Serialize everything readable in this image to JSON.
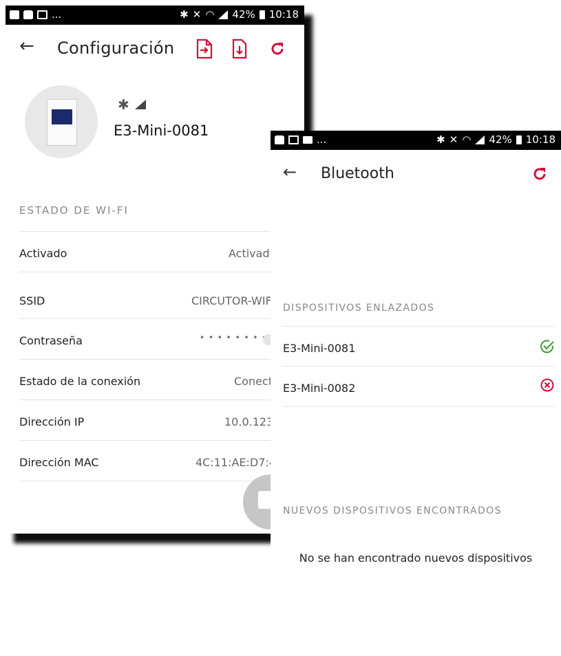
{
  "colors": {
    "accent": "#d0103a",
    "ok": "#3a9d2a",
    "error": "#d0103a"
  },
  "config_screen": {
    "status_bar": {
      "left_ellipsis": "...",
      "battery": "42%",
      "time": "10:18"
    },
    "title": "Configuración",
    "icons": [
      "import-icon",
      "download-icon",
      "refresh-icon"
    ],
    "device_name": "E3-Mini-0081",
    "section_wifi": "ESTADO DE WI-FI",
    "rows": [
      {
        "label": "Activado",
        "value": "Activad"
      },
      {
        "label": "SSID",
        "value": "CIRCUTOR-WIF"
      },
      {
        "label": "Contraseña",
        "value": "• • • • • • • •"
      },
      {
        "label": "Estado de la conexión",
        "value": "Conect"
      },
      {
        "label": "Dirección IP",
        "value": "10.0.123"
      },
      {
        "label": "Dirección MAC",
        "value": "4C:11:AE:D7:4"
      }
    ]
  },
  "bluetooth_screen": {
    "status_bar": {
      "left_ellipsis": "...",
      "battery": "42%",
      "time": "10:18"
    },
    "title": "Bluetooth",
    "section_paired": "DISPOSITIVOS ENLAZADOS",
    "paired": [
      {
        "name": "E3-Mini-0081",
        "status": "connected"
      },
      {
        "name": "E3-Mini-0082",
        "status": "error"
      }
    ],
    "section_new": "NUEVOS DISPOSITIVOS ENCONTRADOS",
    "empty_message": "No se han encontrado nuevos dispositivos"
  }
}
